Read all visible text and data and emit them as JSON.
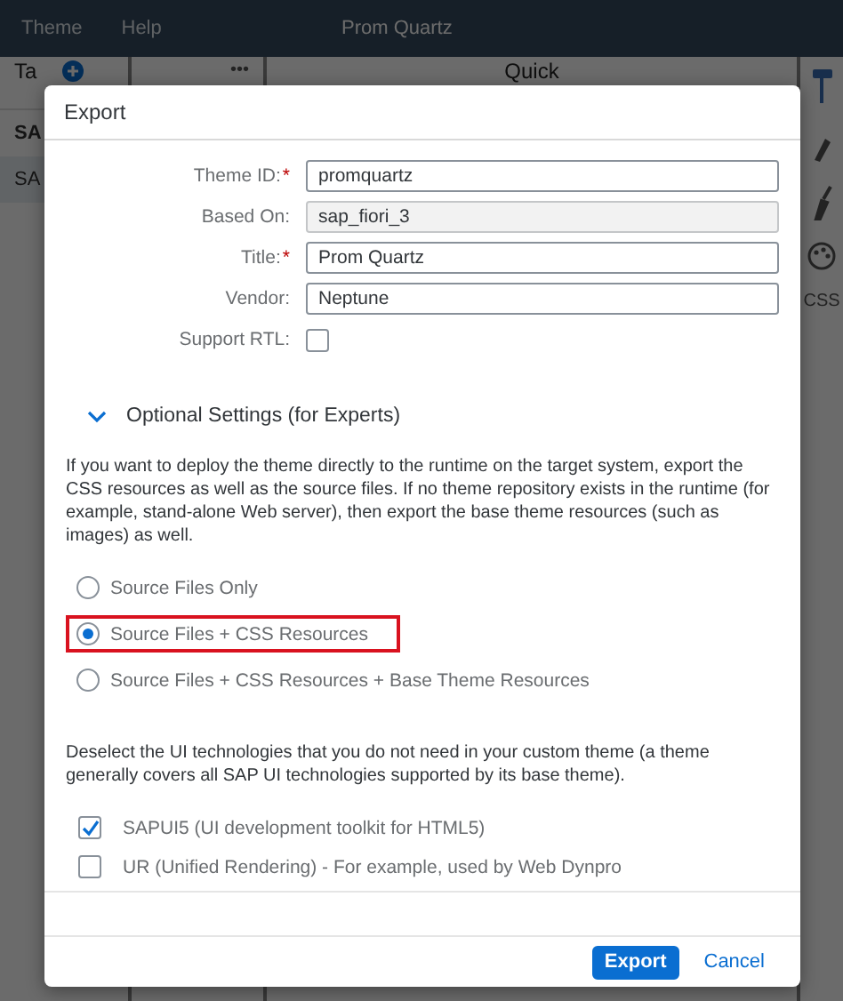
{
  "top_bar": {
    "menus": [
      "Theme",
      "Help"
    ],
    "title": "Prom Quartz"
  },
  "background": {
    "panel_1_title": "Ta",
    "panel_2_menu": "•••",
    "panel_3_title": "Quick",
    "list_items": [
      "SA",
      "SA"
    ],
    "side_label": "CSS"
  },
  "dialog": {
    "title": "Export",
    "fields": [
      {
        "label": "Theme ID:",
        "required_mark": "*",
        "value": "promquartz",
        "disabled": false
      },
      {
        "label": "Based On:",
        "value": "sap_fiori_3",
        "disabled": true
      },
      {
        "label": "Title:",
        "required_mark": "*",
        "value": "Prom Quartz",
        "disabled": false
      },
      {
        "label": "Vendor:",
        "value": "Neptune",
        "disabled": false
      }
    ],
    "support_rtl": {
      "label": "Support RTL:",
      "checked": false
    },
    "section": {
      "title": "Optional Settings (for Experts)",
      "expanded": true
    },
    "info_text": "If you want to deploy the theme directly to the runtime on the target system, export the CSS resources as well as the source files. If no theme repository exists in the runtime (for example, stand-alone Web server), then export the base theme resources (such as images) as well.",
    "export_options": [
      {
        "label": "Source Files Only",
        "selected": false,
        "highlighted": false
      },
      {
        "label": "Source Files + CSS Resources",
        "selected": true,
        "highlighted": true
      },
      {
        "label": "Source Files + CSS Resources + Base Theme Resources",
        "selected": false,
        "highlighted": false
      }
    ],
    "tech_text": "Deselect the UI technologies that you do not need in your custom theme (a theme generally covers all SAP UI technologies supported by its base theme).",
    "technologies": [
      {
        "label": "SAPUI5 (UI development toolkit for HTML5)",
        "checked": true
      },
      {
        "label": "UR (Unified Rendering) - For example, used by Web Dynpro",
        "checked": false
      }
    ],
    "buttons": [
      {
        "label": "Export",
        "kind": "primary"
      },
      {
        "label": "Cancel",
        "kind": "link"
      }
    ]
  }
}
